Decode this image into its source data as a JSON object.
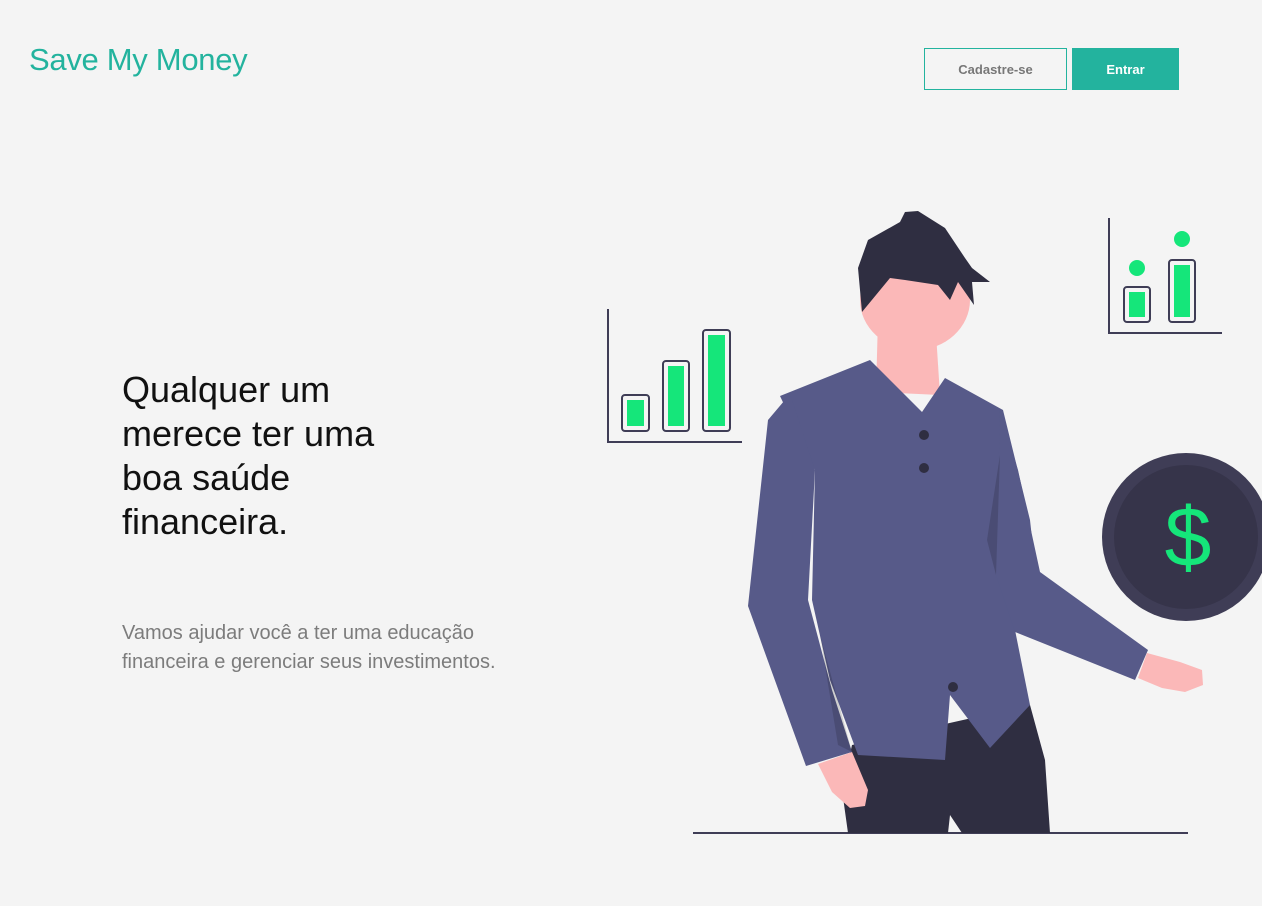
{
  "header": {
    "logo": "Save My Money",
    "signup_label": "Cadastre-se",
    "login_label": "Entrar"
  },
  "hero": {
    "headline": "Qualquer um merece ter uma boa saúde financeira.",
    "subtext": "Vamos ajudar você a ter uma educação financeira e gerenciar seus investimentos."
  },
  "illustration": {
    "coin_symbol": "$",
    "colors": {
      "accent": "#23b39e",
      "bar_green": "#15e67a",
      "shirt": "#575a89",
      "dark": "#2f2e41",
      "skin": "#fbb8b8",
      "coin": "#3f3d56"
    }
  }
}
